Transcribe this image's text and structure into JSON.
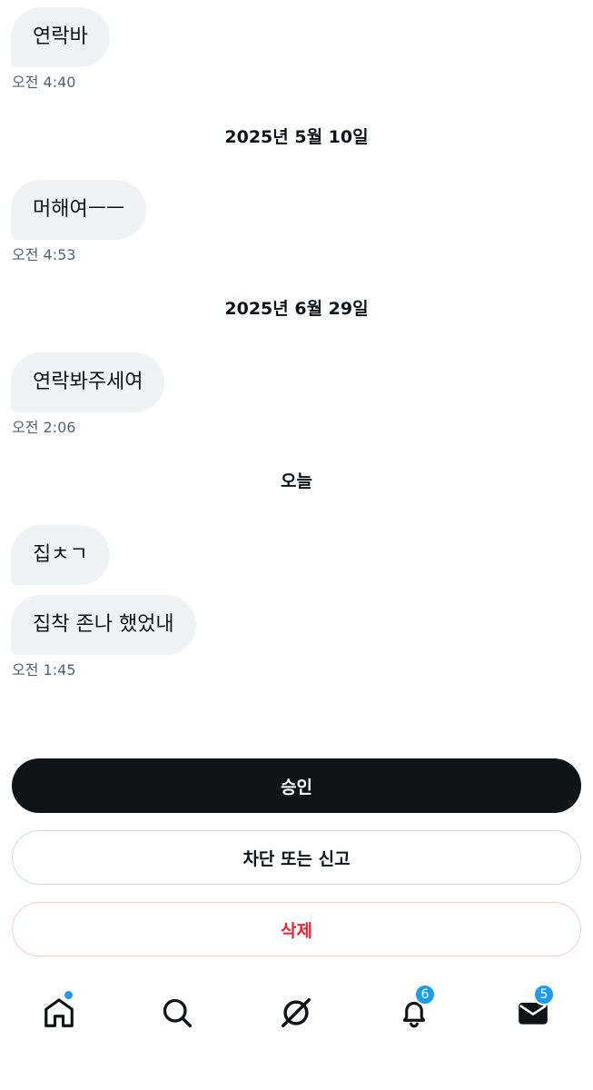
{
  "messages": [
    {
      "text": "연락바",
      "time": "오전 4:40"
    },
    {
      "date": "2025년 5월 10일"
    },
    {
      "text": "머해여ㅡㅡ",
      "time": "오전 4:53"
    },
    {
      "date": "2025년 6월 29일"
    },
    {
      "text": "연락봐주세여",
      "time": "오전 2:06"
    },
    {
      "date": "오늘"
    },
    {
      "text": "집ㅊㄱ"
    },
    {
      "text": "집착 존나 했었내",
      "time": "오전 1:45"
    }
  ],
  "actions": {
    "accept_label": "승인",
    "block_label": "차단 또는 신고",
    "delete_label": "삭제"
  },
  "tabbar": {
    "home": {
      "icon": "home-icon",
      "has_dot": true
    },
    "search": {
      "icon": "search-icon"
    },
    "grok": {
      "icon": "grok-icon"
    },
    "notifications": {
      "icon": "bell-icon",
      "badge": "6"
    },
    "messages": {
      "icon": "mail-icon",
      "badge": "5"
    }
  },
  "colors": {
    "accent": "#1d9bf0",
    "bubble": "#eff3f4",
    "danger": "#f4212e",
    "text": "#0f1419",
    "muted": "#536471"
  }
}
